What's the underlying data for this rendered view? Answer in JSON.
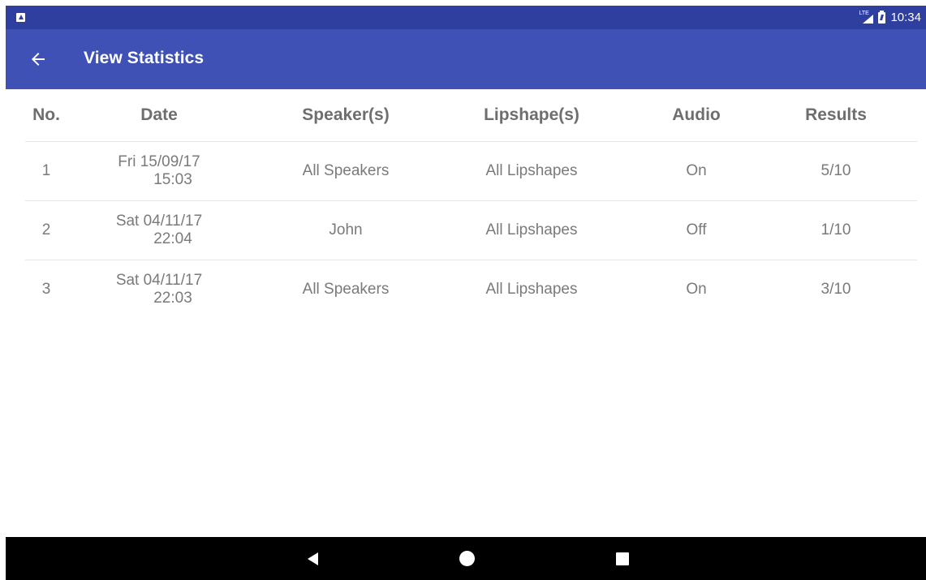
{
  "status_bar": {
    "network": "LTE",
    "time": "10:34",
    "icons": [
      "notification-a-icon",
      "lte-signal-icon",
      "battery-icon"
    ]
  },
  "app_bar": {
    "title": "View Statistics",
    "back_icon": "arrow-left-icon",
    "background_color": "#3f51b5",
    "status_color": "#2f3f9f"
  },
  "table": {
    "headers": {
      "no": "No.",
      "date": "Date",
      "speaker": "Speaker(s)",
      "lipshape": "Lipshape(s)",
      "audio": "Audio",
      "results": "Results"
    },
    "rows": [
      {
        "no": "1",
        "date_line1": "Fri 15/09/17",
        "date_line2": "15:03",
        "speaker": "All Speakers",
        "lipshape": "All Lipshapes",
        "audio": "On",
        "results": "5/10"
      },
      {
        "no": "2",
        "date_line1": "Sat 04/11/17",
        "date_line2": "22:04",
        "speaker": "John",
        "lipshape": "All Lipshapes",
        "audio": "Off",
        "results": "1/10"
      },
      {
        "no": "3",
        "date_line1": "Sat 04/11/17",
        "date_line2": "22:03",
        "speaker": "All Speakers",
        "lipshape": "All Lipshapes",
        "audio": "On",
        "results": "3/10"
      }
    ]
  },
  "nav_bar": {
    "icons": [
      "nav-back-icon",
      "nav-home-icon",
      "nav-recents-icon"
    ]
  }
}
